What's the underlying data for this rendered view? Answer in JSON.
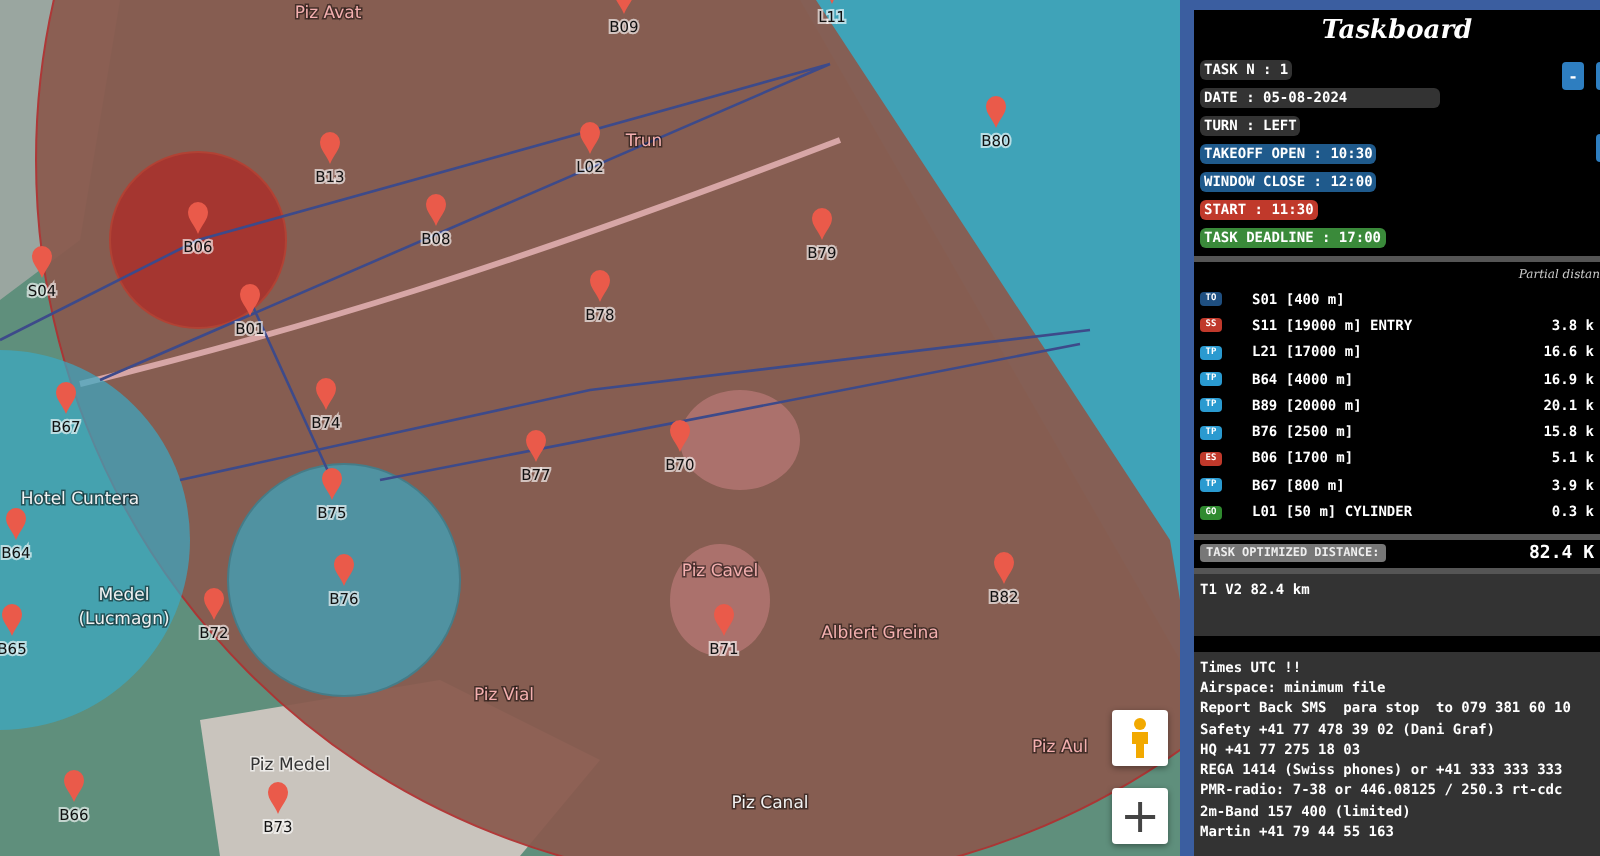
{
  "map": {
    "waypoints": [
      {
        "label": "B09"
      },
      {
        "label": "L11"
      },
      {
        "label": "B13"
      },
      {
        "label": "L02"
      },
      {
        "label": "B80"
      },
      {
        "label": "B06"
      },
      {
        "label": "B08"
      },
      {
        "label": "B79"
      },
      {
        "label": "S04"
      },
      {
        "label": "B01"
      },
      {
        "label": "B78"
      },
      {
        "label": "B67"
      },
      {
        "label": "B74"
      },
      {
        "label": "B77"
      },
      {
        "label": "B70"
      },
      {
        "label": "B75"
      },
      {
        "label": "B64"
      },
      {
        "label": "B76"
      },
      {
        "label": "B72"
      },
      {
        "label": "B65"
      },
      {
        "label": "B71"
      },
      {
        "label": "B82"
      },
      {
        "label": "B66"
      },
      {
        "label": "B73"
      }
    ],
    "place_names": [
      "Piz Avat",
      "Trun",
      "Hotel Cuntera",
      "Medel",
      "(Lucmagn)",
      "Piz Cavel",
      "Albiert Greina",
      "Piz Vial",
      "Piz Medel",
      "Piz Canal",
      "Piz Aul"
    ],
    "zoom_in": "+"
  },
  "taskboard": {
    "title": "Taskboard",
    "collapse_button": "-",
    "task_info": [
      {
        "text": "TASK N : 1",
        "color": "#333333"
      },
      {
        "text": "DATE : 05-08-2024",
        "color": "#333333"
      },
      {
        "text": "TURN : LEFT",
        "color": "#333333"
      },
      {
        "text": "TAKEOFF OPEN : 10:30",
        "color": "#1f5a8c"
      },
      {
        "text": "WINDOW CLOSE : 12:00",
        "color": "#1f5a8c"
      },
      {
        "text": "START : 11:30",
        "color": "#c0392b"
      },
      {
        "text": "TASK DEADLINE : 17:00",
        "color": "#3a8a3a"
      }
    ],
    "distance_header": "Partial distan",
    "turnpoints": [
      {
        "badge": "TO",
        "color": "#1f4f80",
        "name": "S01 [400 m]"
      },
      {
        "badge": "SS",
        "color": "#c0392b",
        "name": "S11 [19000 m] ENTRY",
        "distance": "3.8 k"
      },
      {
        "badge": "TP",
        "color": "#2a9ad0",
        "name": "L21 [17000 m]",
        "distance": "16.6 k"
      },
      {
        "badge": "TP",
        "color": "#2a9ad0",
        "name": "B64 [4000 m]",
        "distance": "16.9 k"
      },
      {
        "badge": "TP",
        "color": "#2a9ad0",
        "name": "B89 [20000 m]",
        "distance": "20.1 k"
      },
      {
        "badge": "TP",
        "color": "#2a9ad0",
        "name": "B76 [2500 m]",
        "distance": "15.8 k"
      },
      {
        "badge": "ES",
        "color": "#c0392b",
        "name": "B06 [1700 m]",
        "distance": "5.1 k"
      },
      {
        "badge": "TP",
        "color": "#2a9ad0",
        "name": "B67 [800 m]",
        "distance": "3.9 k"
      },
      {
        "badge": "GO",
        "color": "#2f8a2f",
        "name": "L01 [50 m] CYLINDER",
        "distance": "0.3 k"
      }
    ],
    "optimized_label": "TASK OPTIMIZED DISTANCE:",
    "optimized_value": "82.4 K",
    "summary": "T1 V2 82.4 km",
    "notes": [
      "Times UTC !!",
      "Airspace: minimum file",
      "Report Back SMS  para stop  to 079 381 60 10",
      "Safety +41 77 478 39 02 (Dani Graf)",
      "HQ +41 77 275 18 03",
      "REGA 1414 (Swiss phones) or +41 333 333 333",
      "PMR-radio: 7-38 or 446.08125 / 250.3 rt-cdc",
      "2m-Band 157 400 (limited)",
      "Martin +41 79 44 55 163"
    ]
  }
}
